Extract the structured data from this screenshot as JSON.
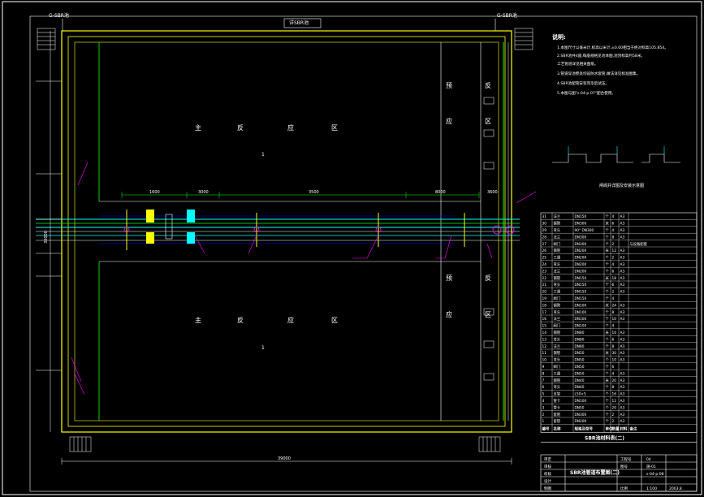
{
  "header": {
    "left_tag": "G-SBR池",
    "center_tag": "详SBR池",
    "right_tag": "G-SBR池"
  },
  "zones": {
    "main_top": [
      "主",
      "反",
      "应",
      "区"
    ],
    "main_bottom": [
      "主",
      "反",
      "应",
      "区"
    ],
    "selector_top": [
      "预",
      "反",
      "应",
      "区"
    ],
    "selector_bottom": [
      "预",
      "反",
      "应",
      "区"
    ],
    "mark_top": "1",
    "mark_bottom": "1"
  },
  "notes": {
    "title": "说明:",
    "lines": [
      "1.本图尺寸以毫米计,标高以米计,±0.00相当于绝对标高105.854。",
      "2.SBR池共4座,每座规格见池体图,池顶标高约58米。",
      "  工艺管道详见相关图纸。",
      "3.管道穿池壁处均设防水套管,做法详见标准图集。",
      "4.SBR池配管安装完毕后试压。",
      "5.本图与图\"s-04-p-07\"配合使用。"
    ]
  },
  "detail": {
    "caption": "闸阀井详图及安装示意图"
  },
  "material_table": {
    "title": "SBR池材料表(二)",
    "headers": [
      "编号",
      "名称",
      "规格及型号",
      "单位",
      "数量",
      "材料",
      "备注"
    ],
    "rows": [
      [
        "31",
        "法兰",
        "DN150",
        "个",
        "4",
        "A3",
        ""
      ],
      [
        "30",
        "钢管",
        "DN300",
        "米",
        "6",
        "A3",
        ""
      ],
      [
        "29",
        "弯头",
        "90° DN300",
        "个",
        "4",
        "A3",
        ""
      ],
      [
        "28",
        "法兰",
        "DN300",
        "个",
        "8",
        "A3",
        ""
      ],
      [
        "27",
        "阀门",
        "DN300",
        "个",
        "2",
        "",
        "与设备配套"
      ],
      [
        "26",
        "钢管",
        "DN200",
        "米",
        "12",
        "A3",
        ""
      ],
      [
        "25",
        "三通",
        "DN200",
        "个",
        "2",
        "A3",
        ""
      ],
      [
        "24",
        "弯头",
        "DN200",
        "个",
        "4",
        "A3",
        ""
      ],
      [
        "23",
        "法兰",
        "DN200",
        "个",
        "6",
        "A3",
        ""
      ],
      [
        "22",
        "钢管",
        "DN150",
        "米",
        "18",
        "A3",
        ""
      ],
      [
        "21",
        "弯头",
        "DN150",
        "个",
        "6",
        "A3",
        ""
      ],
      [
        "20",
        "三通",
        "DN150",
        "个",
        "2",
        "A3",
        ""
      ],
      [
        "19",
        "阀门",
        "DN150",
        "个",
        "4",
        "",
        ""
      ],
      [
        "18",
        "钢管",
        "DN100",
        "米",
        "24",
        "A3",
        ""
      ],
      [
        "17",
        "弯头",
        "DN100",
        "个",
        "8",
        "A3",
        ""
      ],
      [
        "16",
        "法兰",
        "DN100",
        "个",
        "10",
        "A3",
        ""
      ],
      [
        "15",
        "阀门",
        "DN100",
        "个",
        "4",
        "",
        ""
      ],
      [
        "14",
        "钢管",
        "DN80",
        "米",
        "16",
        "A3",
        ""
      ],
      [
        "13",
        "弯头",
        "DN80",
        "个",
        "6",
        "A3",
        ""
      ],
      [
        "12",
        "法兰",
        "DN80",
        "个",
        "8",
        "A3",
        ""
      ],
      [
        "11",
        "钢管",
        "DN50",
        "米",
        "30",
        "A3",
        ""
      ],
      [
        "10",
        "弯头",
        "DN50",
        "个",
        "10",
        "A3",
        ""
      ],
      [
        "9",
        "阀门",
        "DN50",
        "个",
        "6",
        "",
        ""
      ],
      [
        "8",
        "三通",
        "DN50",
        "个",
        "4",
        "A3",
        ""
      ],
      [
        "7",
        "钢管",
        "DN40",
        "米",
        "20",
        "A3",
        ""
      ],
      [
        "6",
        "弯头",
        "DN40",
        "个",
        "8",
        "A3",
        ""
      ],
      [
        "5",
        "支架",
        "L50×5",
        "个",
        "16",
        "A3",
        ""
      ],
      [
        "4",
        "管卡",
        "DN100",
        "个",
        "12",
        "A3",
        ""
      ],
      [
        "3",
        "管卡",
        "DN50",
        "个",
        "20",
        "A3",
        ""
      ],
      [
        "2",
        "套管",
        "DN300",
        "个",
        "2",
        "A3",
        ""
      ],
      [
        "1",
        "套管",
        "DN200",
        "个",
        "2",
        "A3",
        ""
      ]
    ]
  },
  "title_block": {
    "drawing_name": "SBR池管道布置图(二)",
    "labels": [
      "审定",
      "审核",
      "校核",
      "设计",
      "制图"
    ],
    "project_label": "工程号",
    "project_value": "04",
    "sheet_label": "图号",
    "sheet_value": "s-04-p-08",
    "phase_value": "施-01",
    "scale_label": "比例",
    "scale_value": "1:100",
    "date_value": "2003.8"
  },
  "dimensions": {
    "bottom_total": "39000",
    "left_total": "30000",
    "pipe_run": [
      "1600",
      "3000",
      "3500",
      "8000",
      "3600"
    ]
  },
  "colors": {
    "background": "#000000",
    "pool_wall": "#ffff00",
    "inner_line": "#00ff00",
    "pipe": "#00ffff",
    "leader": "#ff00ff",
    "text": "#ffffff"
  }
}
